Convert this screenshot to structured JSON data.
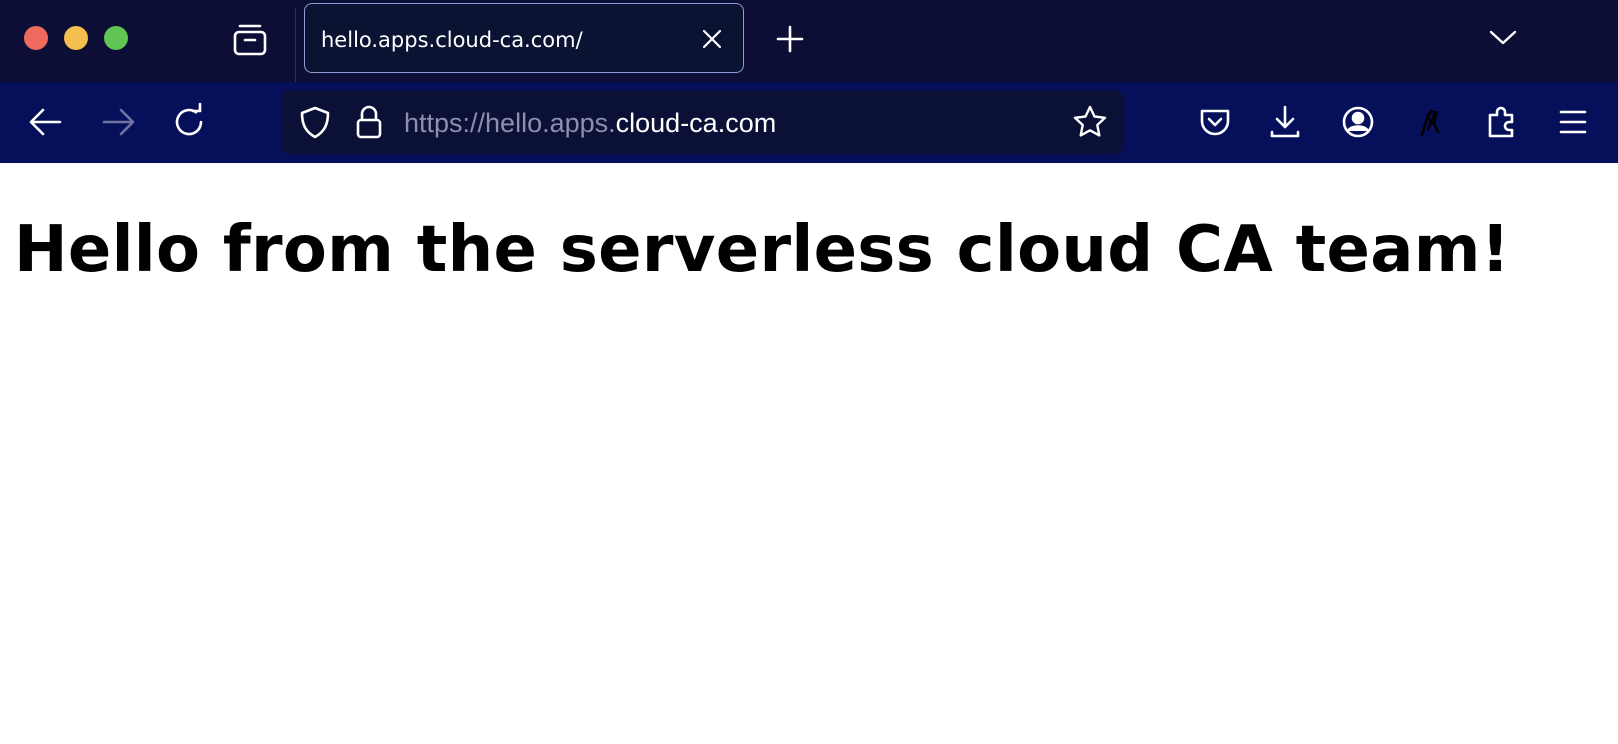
{
  "window": {
    "controls": {
      "close_color": "#ee6a5f",
      "minimize_color": "#f5bf4f",
      "maximize_color": "#61c554"
    }
  },
  "tabs": [
    {
      "title": "hello.apps.cloud-ca.com/",
      "active": true
    }
  ],
  "toolbar": {
    "url": {
      "prefix": "https://hello.apps.",
      "domain": "cloud-ca.com"
    },
    "icons": [
      "back-arrow-icon",
      "forward-arrow-icon",
      "reload-icon",
      "shield-icon",
      "lock-icon",
      "bookmark-star-icon",
      "pocket-icon",
      "download-icon",
      "account-icon",
      "extension-icon",
      "puzzle-icon",
      "menu-icon"
    ]
  },
  "page": {
    "heading": "Hello from the serverless cloud CA team!"
  },
  "colors": {
    "titlebar": "#0c0e35",
    "navbar": "#06105a",
    "urlbar": "#0b1036"
  }
}
